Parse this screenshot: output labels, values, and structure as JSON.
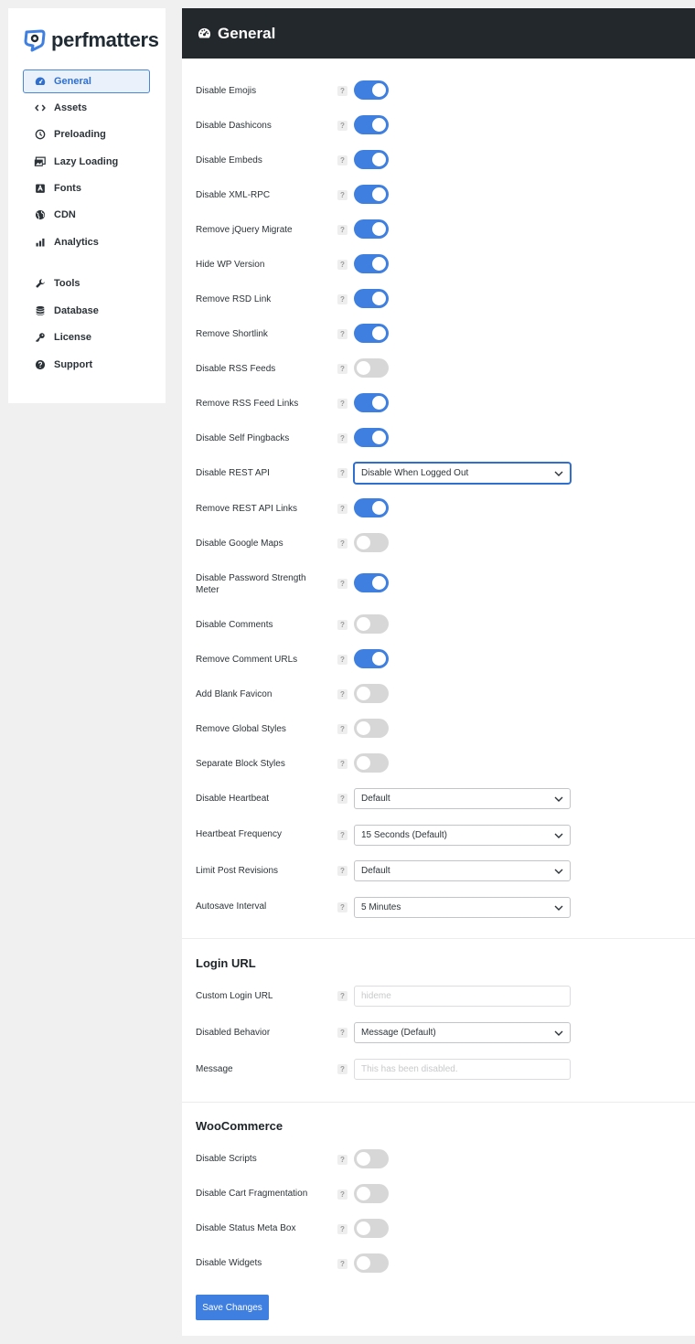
{
  "brand": {
    "name": "perfmatters",
    "accent": "#3f7fe0"
  },
  "sidebar": {
    "items": [
      {
        "label": "General",
        "icon": "dashboard-icon",
        "active": true
      },
      {
        "label": "Assets",
        "icon": "code-icon"
      },
      {
        "label": "Preloading",
        "icon": "clock-icon"
      },
      {
        "label": "Lazy Loading",
        "icon": "images-icon"
      },
      {
        "label": "Fonts",
        "icon": "font-icon"
      },
      {
        "label": "CDN",
        "icon": "globe-icon"
      },
      {
        "label": "Analytics",
        "icon": "bar-chart-icon"
      },
      {
        "label": "Tools",
        "icon": "wrench-icon"
      },
      {
        "label": "Database",
        "icon": "database-icon"
      },
      {
        "label": "License",
        "icon": "key-icon"
      },
      {
        "label": "Support",
        "icon": "question-circle-icon"
      }
    ]
  },
  "header": {
    "title": "General",
    "icon": "dashboard-icon"
  },
  "options": [
    {
      "label": "Disable Emojis",
      "type": "toggle",
      "on": true
    },
    {
      "label": "Disable Dashicons",
      "type": "toggle",
      "on": true
    },
    {
      "label": "Disable Embeds",
      "type": "toggle",
      "on": true
    },
    {
      "label": "Disable XML-RPC",
      "type": "toggle",
      "on": true
    },
    {
      "label": "Remove jQuery Migrate",
      "type": "toggle",
      "on": true
    },
    {
      "label": "Hide WP Version",
      "type": "toggle",
      "on": true
    },
    {
      "label": "Remove RSD Link",
      "type": "toggle",
      "on": true
    },
    {
      "label": "Remove Shortlink",
      "type": "toggle",
      "on": true
    },
    {
      "label": "Disable RSS Feeds",
      "type": "toggle",
      "on": false
    },
    {
      "label": "Remove RSS Feed Links",
      "type": "toggle",
      "on": true
    },
    {
      "label": "Disable Self Pingbacks",
      "type": "toggle",
      "on": true
    },
    {
      "label": "Disable REST API",
      "type": "select",
      "value": "Disable When Logged Out",
      "focused": true
    },
    {
      "label": "Remove REST API Links",
      "type": "toggle",
      "on": true
    },
    {
      "label": "Disable Google Maps",
      "type": "toggle",
      "on": false
    },
    {
      "label": "Disable Password Strength Meter",
      "type": "toggle",
      "on": true
    },
    {
      "label": "Disable Comments",
      "type": "toggle",
      "on": false
    },
    {
      "label": "Remove Comment URLs",
      "type": "toggle",
      "on": true
    },
    {
      "label": "Add Blank Favicon",
      "type": "toggle",
      "on": false
    },
    {
      "label": "Remove Global Styles",
      "type": "toggle",
      "on": false
    },
    {
      "label": "Separate Block Styles",
      "type": "toggle",
      "on": false
    },
    {
      "label": "Disable Heartbeat",
      "type": "select",
      "value": "Default"
    },
    {
      "label": "Heartbeat Frequency",
      "type": "select",
      "value": "15 Seconds (Default)"
    },
    {
      "label": "Limit Post Revisions",
      "type": "select",
      "value": "Default"
    },
    {
      "label": "Autosave Interval",
      "type": "select",
      "value": "5 Minutes"
    }
  ],
  "login": {
    "title": "Login URL",
    "fields": [
      {
        "label": "Custom Login URL",
        "type": "text",
        "placeholder": "hideme"
      },
      {
        "label": "Disabled Behavior",
        "type": "select",
        "value": "Message (Default)"
      },
      {
        "label": "Message",
        "type": "text",
        "placeholder": "This has been disabled."
      }
    ]
  },
  "woocommerce": {
    "title": "WooCommerce",
    "options": [
      {
        "label": "Disable Scripts",
        "type": "toggle",
        "on": false
      },
      {
        "label": "Disable Cart Fragmentation",
        "type": "toggle",
        "on": false
      },
      {
        "label": "Disable Status Meta Box",
        "type": "toggle",
        "on": false
      },
      {
        "label": "Disable Widgets",
        "type": "toggle",
        "on": false
      }
    ]
  },
  "save_label": "Save Changes",
  "help_glyph": "?"
}
